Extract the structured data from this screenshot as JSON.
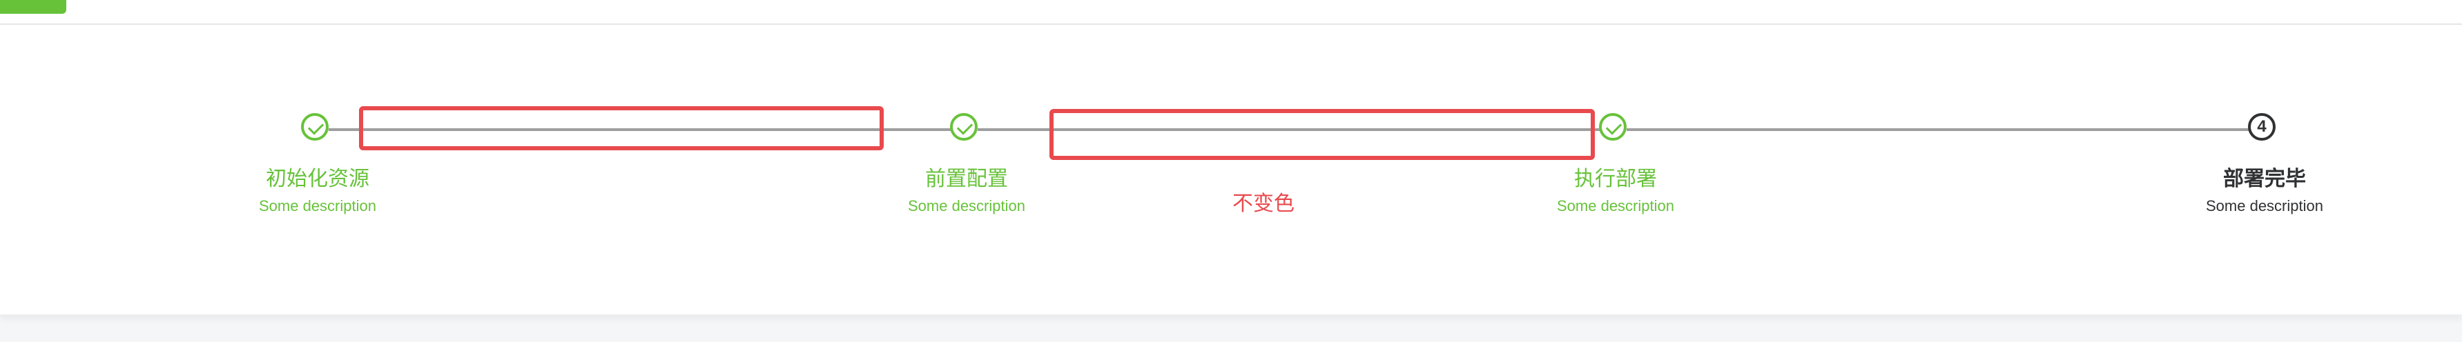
{
  "steps": [
    {
      "title": "初始化资源",
      "description": "Some description",
      "status": "finish",
      "icon": "check-icon"
    },
    {
      "title": "前置配置",
      "description": "Some description",
      "status": "finish",
      "icon": "check-icon"
    },
    {
      "title": "执行部署",
      "description": "Some description",
      "status": "finish",
      "icon": "check-icon"
    },
    {
      "title": "部署完毕",
      "description": "Some description",
      "status": "wait",
      "number": "4"
    }
  ],
  "annotation": {
    "label": "不变色"
  },
  "colors": {
    "success": "#67c23a",
    "annotation": "#e84a4d",
    "text_primary": "#303133",
    "line_grey": "#9e9e9e"
  }
}
